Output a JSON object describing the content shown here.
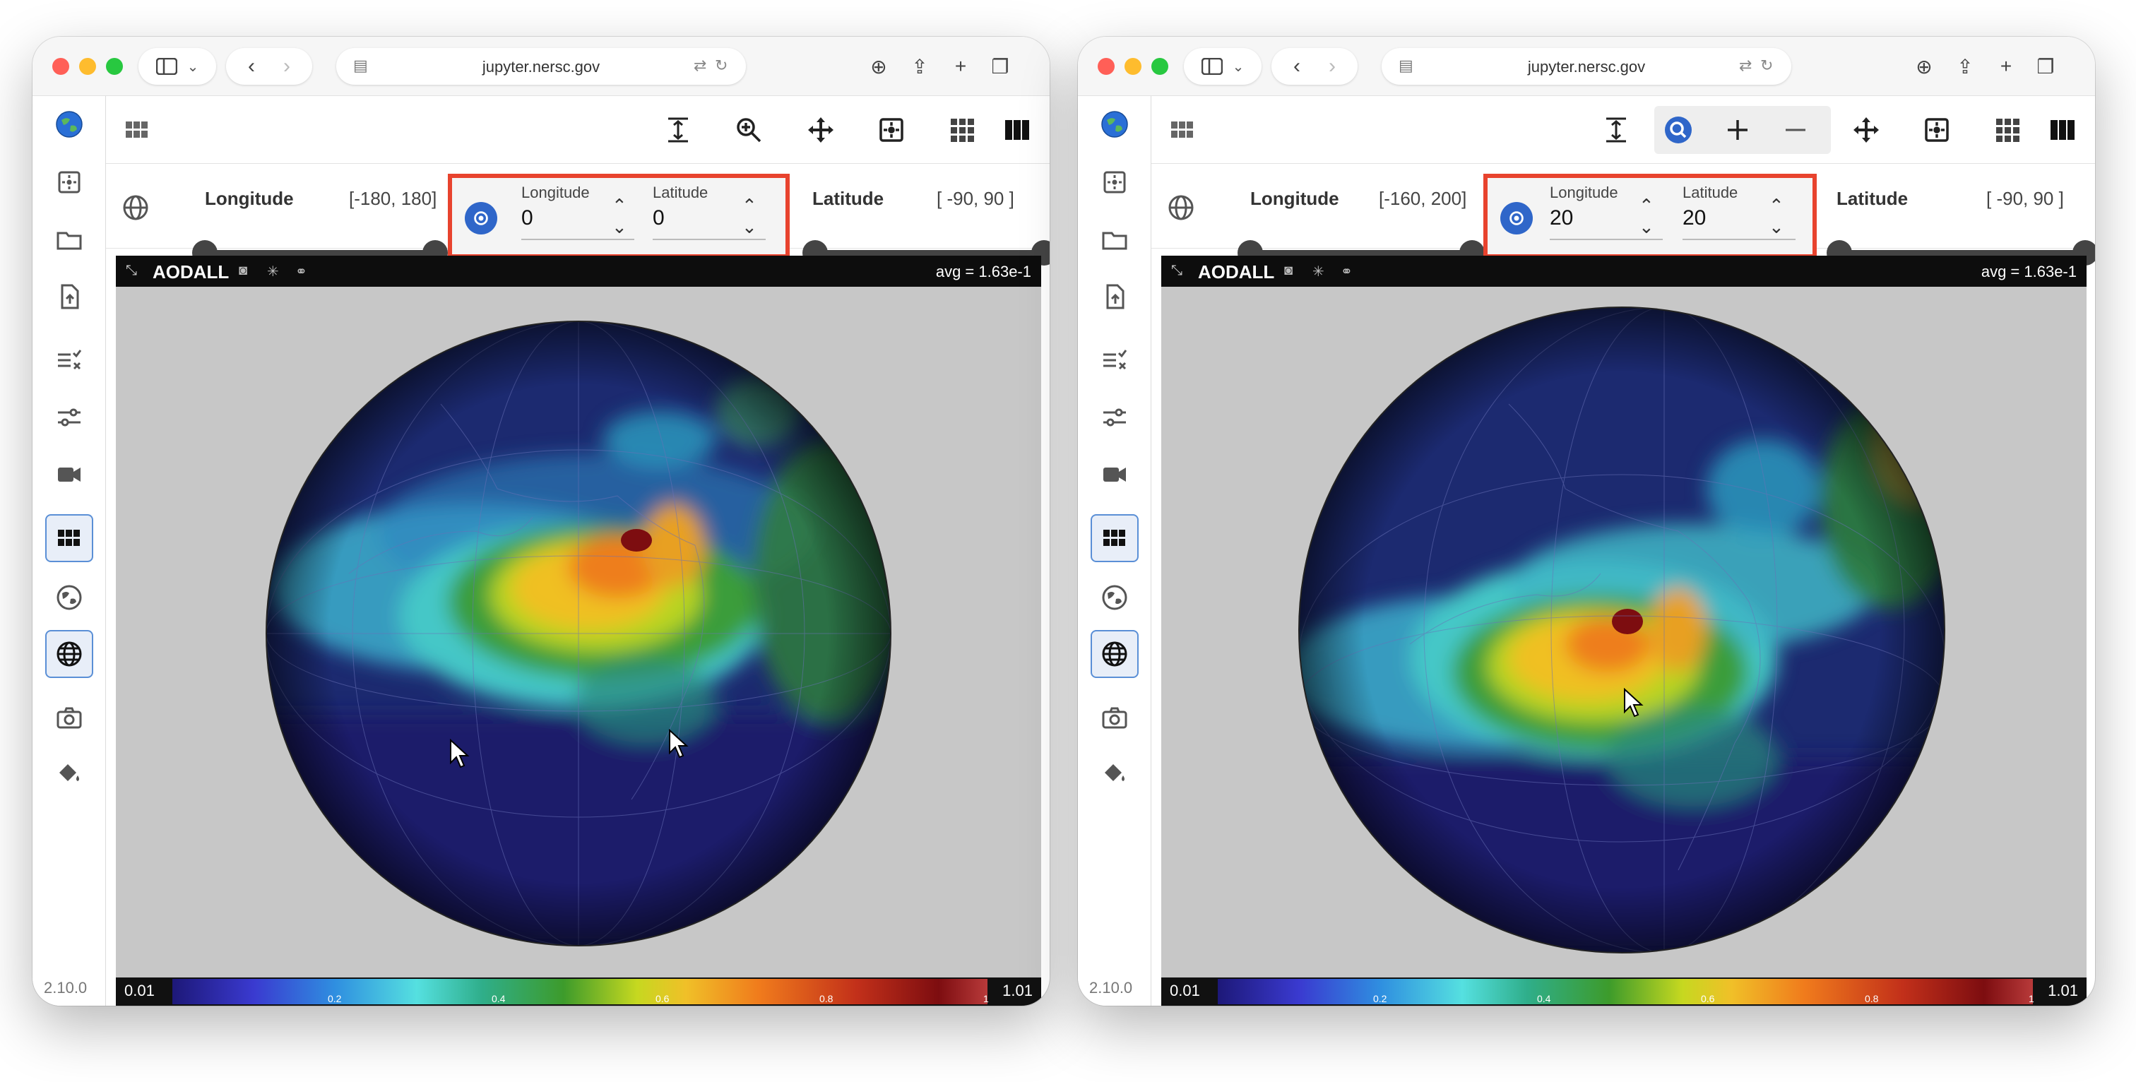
{
  "left": {
    "url": "jupyter.nersc.gov",
    "version": "2.10.0",
    "longitude_label": "Longitude",
    "longitude_range": "[-180, 180]",
    "latitude_label": "Latitude",
    "latitude_range": "[ -90, 90 ]",
    "center_longitude_label": "Longitude",
    "center_longitude_value": "0",
    "center_latitude_label": "Latitude",
    "center_latitude_value": "0",
    "variable": "AODALL",
    "avg": "avg = 1.63e-1",
    "colorbar_min": "0.01",
    "colorbar_max": "1.01"
  },
  "right": {
    "url": "jupyter.nersc.gov",
    "version": "2.10.0",
    "longitude_label": "Longitude",
    "longitude_range": "[-160, 200]",
    "latitude_label": "Latitude",
    "latitude_range": "[ -90, 90 ]",
    "center_longitude_label": "Longitude",
    "center_longitude_value": "20",
    "center_latitude_label": "Latitude",
    "center_latitude_value": "20",
    "variable": "AODALL",
    "avg": "avg = 1.63e-1",
    "colorbar_min": "0.01",
    "colorbar_max": "1.01"
  },
  "colorbar_ticks": [
    "0.2",
    "0.4",
    "0.6",
    "0.8",
    "1"
  ],
  "colors": {
    "highlight_border": "#e8432e",
    "accent_blue": "#2f66c9",
    "viewer_background": "#c7c7c7"
  }
}
